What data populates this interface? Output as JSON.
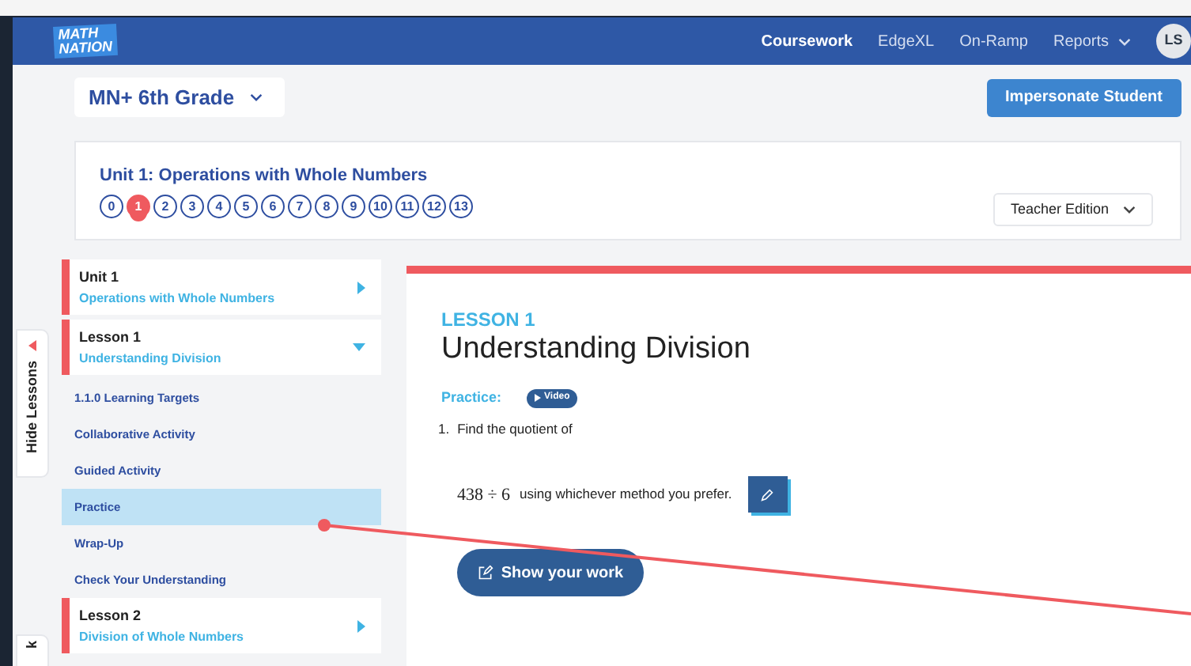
{
  "nav": {
    "logo": [
      "MATH",
      "NATION"
    ],
    "links": [
      {
        "label": "Coursework",
        "selected": true,
        "dropdown": false
      },
      {
        "label": "EdgeXL",
        "selected": false,
        "dropdown": false
      },
      {
        "label": "On-Ramp",
        "selected": false,
        "dropdown": false
      },
      {
        "label": "Reports",
        "selected": false,
        "dropdown": true
      }
    ],
    "avatar": "LS"
  },
  "course_select": "MN+ 6th Grade",
  "impersonate_button": "Impersonate Student",
  "unit": {
    "title": "Unit 1: Operations with Whole Numbers",
    "lessons": [
      {
        "label": "0",
        "selected": false
      },
      {
        "label": "1",
        "selected": true
      },
      {
        "label": "2",
        "selected": false
      },
      {
        "label": "3",
        "selected": false
      },
      {
        "label": "4",
        "selected": false
      },
      {
        "label": "5",
        "selected": false
      },
      {
        "label": "6",
        "selected": false
      },
      {
        "label": "7",
        "selected": false
      },
      {
        "label": "8",
        "selected": false
      },
      {
        "label": "9",
        "selected": false
      },
      {
        "label": "10",
        "selected": false
      },
      {
        "label": "11",
        "selected": false
      },
      {
        "label": "12",
        "selected": false
      },
      {
        "label": "13",
        "selected": false
      }
    ],
    "edition_select": "Teacher Edition"
  },
  "side_tabs": [
    "Hide Lessons",
    "k"
  ],
  "sidebar": {
    "items": [
      {
        "kind": "header",
        "label": "Unit 1",
        "subtitle": "Operations with Whole Numbers",
        "expanded": false
      },
      {
        "kind": "header",
        "label": "Lesson 1",
        "subtitle": "Understanding Division",
        "expanded": true
      },
      {
        "kind": "link",
        "label": "1.1.0 Learning Targets",
        "selected": false
      },
      {
        "kind": "link",
        "label": "Collaborative Activity",
        "selected": false
      },
      {
        "kind": "link",
        "label": "Guided Activity",
        "selected": false
      },
      {
        "kind": "link",
        "label": "Practice",
        "selected": true
      },
      {
        "kind": "link",
        "label": "Wrap-Up",
        "selected": false
      },
      {
        "kind": "link",
        "label": "Check Your Understanding",
        "selected": false
      },
      {
        "kind": "header",
        "label": "Lesson 2",
        "subtitle": "Division of Whole Numbers",
        "expanded": false
      }
    ]
  },
  "lesson": {
    "eyebrow": "LESSON 1",
    "title": "Understanding Division",
    "section": "Practice:",
    "video_button": "Video",
    "question": {
      "number": "1.",
      "text": "Find the quotient of",
      "expression": "438 ÷ 6",
      "rest": "using whichever method you prefer."
    },
    "show_work_button": "Show your work"
  }
}
